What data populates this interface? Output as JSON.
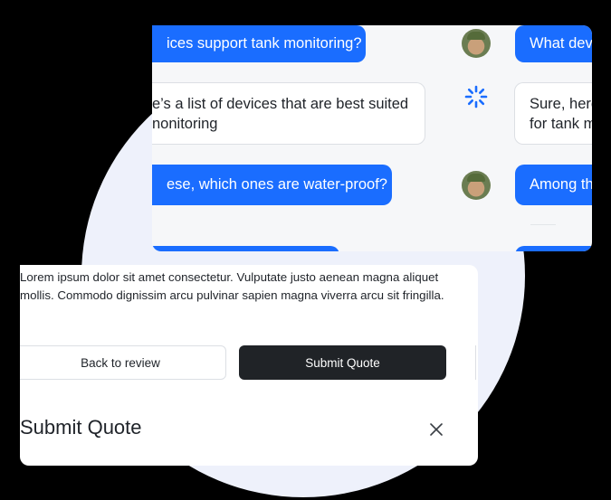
{
  "chat": {
    "messages_left": [
      {
        "text": "ices support tank monitoring?",
        "role": "user"
      },
      {
        "line1": "e’s a list of devices that are best suited",
        "line2": "nonitoring",
        "role": "assistant"
      },
      {
        "text": "ese, which ones are water-proof?",
        "role": "user"
      }
    ],
    "messages_right": [
      {
        "text": "What dev",
        "role": "user"
      },
      {
        "line1": "Sure, here",
        "line2": "for tank m",
        "role": "assistant"
      },
      {
        "text": "Among th",
        "role": "user"
      }
    ]
  },
  "quote": {
    "body_text": "Lorem ipsum dolor sit amet consectetur. Vulputate justo aenean magna aliquet mollis. Commodo dignissim arcu pulvinar sapien magna viverra arcu sit fringilla.",
    "back_button": "Back to review",
    "submit_button": "Submit Quote",
    "title": "Submit Quote"
  },
  "colors": {
    "accent": "#1a6dff",
    "dark_button": "#202327",
    "background": "#000000",
    "blob": "#eef1fb"
  },
  "icons": [
    "user-avatar-icon",
    "loading-spinner-icon",
    "close-icon"
  ]
}
